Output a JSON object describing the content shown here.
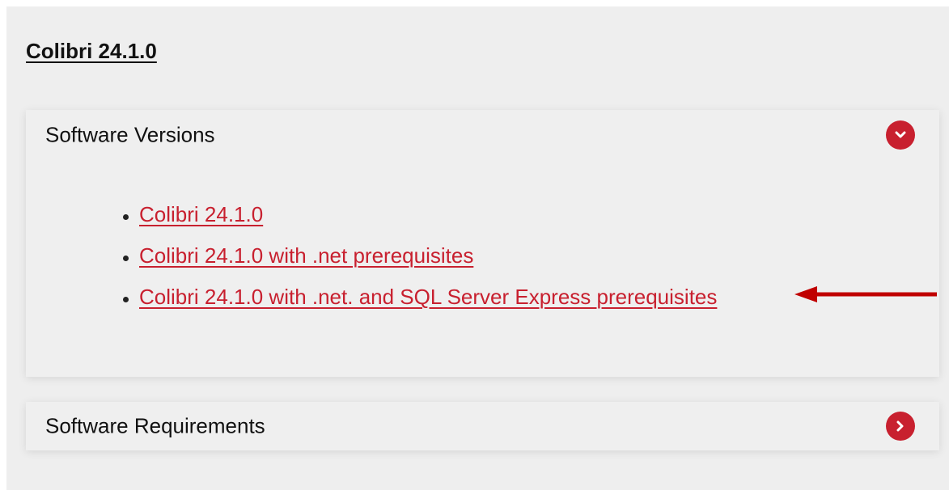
{
  "page": {
    "title": "Colibri 24.1.0"
  },
  "versions_panel": {
    "title": "Software Versions",
    "toggle_icon": "chevron-down-icon",
    "links": [
      {
        "label": "Colibri 24.1.0"
      },
      {
        "label": "Colibri 24.1.0 with .net prerequisites"
      },
      {
        "label": "Colibri 24.1.0 with .net. and SQL Server Express prerequisites"
      }
    ]
  },
  "requirements_panel": {
    "title": "Software Requirements",
    "toggle_icon": "chevron-right-icon"
  },
  "annotation": {
    "icon": "red-arrow-left-icon",
    "color": "#c00000"
  },
  "colors": {
    "accent": "#c8202f",
    "panel_bg": "#efefef",
    "page_bg": "#eeeeee",
    "text": "#111111"
  }
}
